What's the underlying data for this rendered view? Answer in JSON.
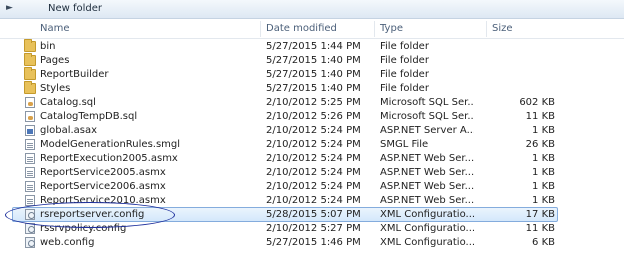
{
  "toolbar": {
    "nav_icon": "chevron-right-icon",
    "new_folder_label": "New folder"
  },
  "columns": {
    "name": "Name",
    "date_modified": "Date modified",
    "type": "Type",
    "size": "Size"
  },
  "files": [
    {
      "name": "bin",
      "date": "5/27/2015 1:44 PM",
      "type": "File folder",
      "size": "",
      "icon": "folder-icon"
    },
    {
      "name": "Pages",
      "date": "5/27/2015 1:40 PM",
      "type": "File folder",
      "size": "",
      "icon": "folder-icon"
    },
    {
      "name": "ReportBuilder",
      "date": "5/27/2015 1:40 PM",
      "type": "File folder",
      "size": "",
      "icon": "folder-icon"
    },
    {
      "name": "Styles",
      "date": "5/27/2015 1:40 PM",
      "type": "File folder",
      "size": "",
      "icon": "folder-icon"
    },
    {
      "name": "Catalog.sql",
      "date": "2/10/2012 5:25 PM",
      "type": "Microsoft SQL Ser...",
      "size": "602 KB",
      "icon": "sql-file-icon"
    },
    {
      "name": "CatalogTempDB.sql",
      "date": "2/10/2012 5:26 PM",
      "type": "Microsoft SQL Ser...",
      "size": "11 KB",
      "icon": "sql-file-icon"
    },
    {
      "name": "global.asax",
      "date": "2/10/2012 5:24 PM",
      "type": "ASP.NET Server A...",
      "size": "1 KB",
      "icon": "asax-file-icon"
    },
    {
      "name": "ModelGenerationRules.smgl",
      "date": "2/10/2012 5:24 PM",
      "type": "SMGL File",
      "size": "26 KB",
      "icon": "document-icon"
    },
    {
      "name": "ReportExecution2005.asmx",
      "date": "2/10/2012 5:24 PM",
      "type": "ASP.NET Web Ser...",
      "size": "1 KB",
      "icon": "document-icon"
    },
    {
      "name": "ReportService2005.asmx",
      "date": "2/10/2012 5:24 PM",
      "type": "ASP.NET Web Ser...",
      "size": "1 KB",
      "icon": "document-icon"
    },
    {
      "name": "ReportService2006.asmx",
      "date": "2/10/2012 5:24 PM",
      "type": "ASP.NET Web Ser...",
      "size": "1 KB",
      "icon": "document-icon"
    },
    {
      "name": "ReportService2010.asmx",
      "date": "2/10/2012 5:24 PM",
      "type": "ASP.NET Web Ser...",
      "size": "1 KB",
      "icon": "document-icon"
    },
    {
      "name": "rsreportserver.config",
      "date": "5/28/2015 5:07 PM",
      "type": "XML Configuratio...",
      "size": "17 KB",
      "icon": "config-file-icon",
      "selected": true
    },
    {
      "name": "rssrvpolicy.config",
      "date": "2/10/2012 5:27 PM",
      "type": "XML Configuratio...",
      "size": "11 KB",
      "icon": "config-file-icon"
    },
    {
      "name": "web.config",
      "date": "5/27/2015 1:46 PM",
      "type": "XML Configuratio...",
      "size": "6 KB",
      "icon": "config-file-icon"
    }
  ],
  "colors": {
    "annotation_ellipse": "#1d2f9c",
    "selection_border": "#84acdd",
    "header_text": "#4c607a"
  }
}
